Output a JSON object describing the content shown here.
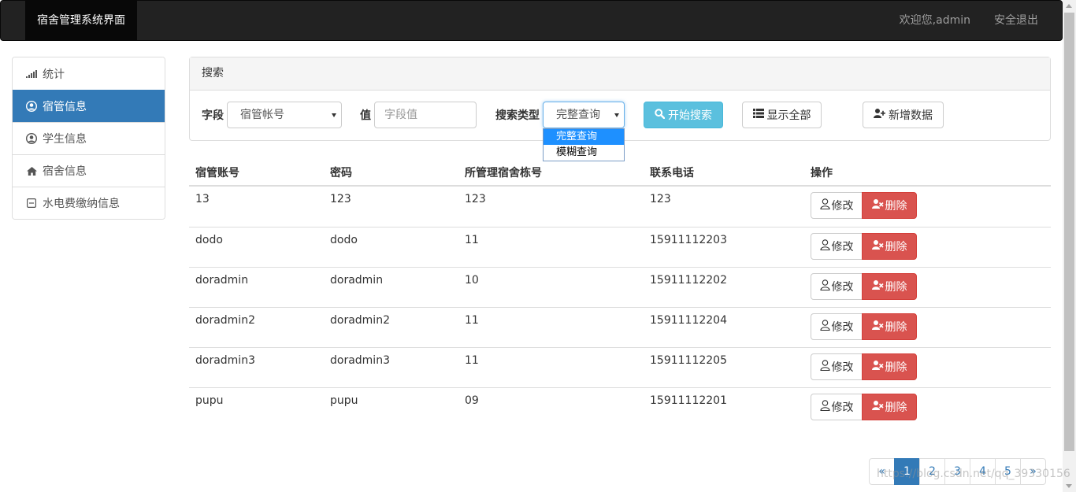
{
  "navbar": {
    "brand": "宿舍管理系统界面",
    "welcome": "欢迎您,admin",
    "logout": "安全退出"
  },
  "sidebar": {
    "items": [
      {
        "label": "统计",
        "icon": "signal-icon"
      },
      {
        "label": "宿管信息",
        "icon": "user-circle-icon"
      },
      {
        "label": "学生信息",
        "icon": "user-circle-icon"
      },
      {
        "label": "宿舍信息",
        "icon": "home-icon"
      },
      {
        "label": "水电费缴纳信息",
        "icon": "minus-square-icon"
      }
    ]
  },
  "search": {
    "panel_title": "搜索",
    "field_label": "字段",
    "field_value": "宿管帐号",
    "value_label": "值",
    "value_placeholder": "字段值",
    "type_label": "搜索类型",
    "type_value": "完整查询",
    "type_options": [
      "完整查询",
      "模糊查询"
    ],
    "search_button": "开始搜索",
    "show_all_button": "显示全部",
    "add_button": "新增数据"
  },
  "table": {
    "headers": [
      "宿管账号",
      "密码",
      "所管理宿舍栋号",
      "联系电话",
      "操作"
    ],
    "rows": [
      [
        "13",
        "123",
        "123",
        "123"
      ],
      [
        "dodo",
        "dodo",
        "11",
        "15911112203"
      ],
      [
        "doradmin",
        "doradmin",
        "10",
        "15911112202"
      ],
      [
        "doradmin2",
        "doradmin2",
        "11",
        "15911112204"
      ],
      [
        "doradmin3",
        "doradmin3",
        "11",
        "15911112205"
      ],
      [
        "pupu",
        "pupu",
        "09",
        "15911112201"
      ]
    ],
    "edit_label": "修改",
    "delete_label": "删除"
  },
  "pagination": {
    "prev": "«",
    "pages": [
      "1",
      "2",
      "3",
      "4",
      "5"
    ],
    "next": "»",
    "current": "1"
  },
  "watermark": "https://blog.csdn.net/qq_39330156",
  "colors": {
    "primary": "#337ab7",
    "info": "#5bc0de",
    "danger": "#d9534f",
    "navbar": "#222222"
  }
}
